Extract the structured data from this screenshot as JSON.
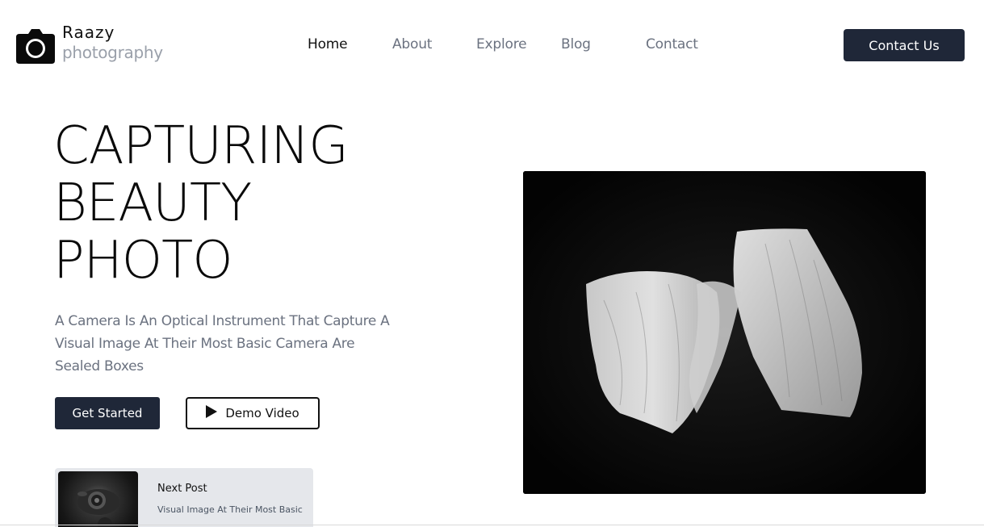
{
  "brand": {
    "name": "Raazy",
    "tagline": "photography",
    "icon": "camera-icon"
  },
  "nav": {
    "items": [
      {
        "label": "Home",
        "active": true
      },
      {
        "label": "About",
        "active": false
      },
      {
        "label": "Explore",
        "active": false
      },
      {
        "label": "Blog",
        "active": false
      },
      {
        "label": "Contact",
        "active": false
      }
    ]
  },
  "header": {
    "cta_label": "Contact Us"
  },
  "hero": {
    "title_lines": [
      "CAPTURING",
      "BEAUTY",
      "PHOTO"
    ],
    "description": "A Camera Is An Optical Instrument That Capture A Visual Image At Their Most Basic Camera Are Sealed Boxes",
    "primary_button": "Get Started",
    "secondary_button": "Demo Video",
    "secondary_icon": "play-icon"
  },
  "next_post": {
    "label": "Next Post",
    "text": "Visual Image At Their Most Basic"
  },
  "colors": {
    "accent": "#1f2738",
    "muted_text": "#6b7280",
    "card_bg": "#e5e7eb"
  }
}
